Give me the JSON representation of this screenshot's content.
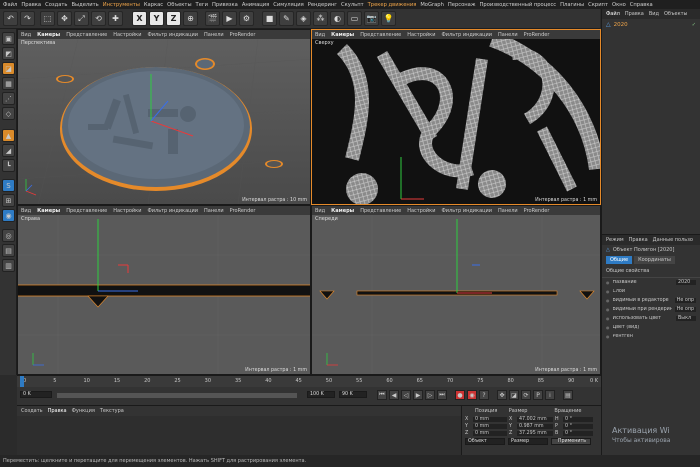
{
  "menubar": {
    "items": [
      "Файл",
      "Правка",
      "Создать",
      "Выделить",
      "Инструменты",
      "Каркас",
      "Объекты",
      "Теги",
      "Привязка",
      "Анимация",
      "Симуляция",
      "Рендеринг",
      "Скульпт",
      "Трекер движения",
      "MoGraph",
      "Персонаж",
      "Производственный процесс",
      "Плагины",
      "Скрипт",
      "Окно",
      "Справка"
    ],
    "highlight": [
      4,
      13
    ]
  },
  "toolbar": {
    "axis_buttons": [
      "X",
      "Y",
      "Z"
    ]
  },
  "viewports": [
    {
      "name": "Перспектива",
      "menu": [
        "Вид",
        "Камеры",
        "Представление",
        "Настройки",
        "Фильтр индикации",
        "Панели",
        "ProRender"
      ],
      "grid": "Интервал растра : 10 mm"
    },
    {
      "name": "Сверху",
      "menu": [
        "Вид",
        "Камеры",
        "Представление",
        "Настройки",
        "Фильтр индикации",
        "Панели",
        "ProRender"
      ],
      "grid": "Интервал растра : 1 mm"
    },
    {
      "name": "Справа",
      "menu": [
        "Вид",
        "Камеры",
        "Представление",
        "Настройки",
        "Фильтр индикации",
        "Панели",
        "ProRender"
      ],
      "grid": "Интервал растра : 1 mm"
    },
    {
      "name": "Спереди",
      "menu": [
        "Вид",
        "Камеры",
        "Представление",
        "Настройки",
        "Фильтр индикации",
        "Панели",
        "ProRender"
      ],
      "grid": "Интервал растра : 1 mm"
    }
  ],
  "object_manager": {
    "tabs": [
      "Файл",
      "Правка",
      "Вид",
      "Объекты"
    ],
    "object_name": "2020"
  },
  "attribute_manager": {
    "tabs": [
      "Режим",
      "Правка",
      "Данные пользо"
    ],
    "title": "Объект Полигон [2020]",
    "subtabs": [
      "Общие",
      "Координаты"
    ],
    "section": "Общие свойства",
    "rows": [
      {
        "label": "Название",
        "value": "2020"
      },
      {
        "label": "Слой",
        "value": ""
      },
      {
        "label": "Видимый в редакторе",
        "value": "Не опр"
      },
      {
        "label": "Видимый при рендеринге",
        "value": "Не опр"
      },
      {
        "label": "Использовать цвет",
        "value": "Выкл"
      },
      {
        "label": "Цвет (вид)",
        "value": ""
      },
      {
        "label": "Рентген",
        "value": ""
      }
    ]
  },
  "timeline": {
    "ticks": [
      "0",
      "5",
      "10",
      "15",
      "20",
      "25",
      "30",
      "35",
      "40",
      "45",
      "50",
      "55",
      "60",
      "65",
      "70",
      "75",
      "80",
      "85",
      "90"
    ],
    "end_label": "0 K",
    "current_frame": "0 K",
    "start_field": "0 K",
    "end_field": "90 K",
    "end_field2": "100 K"
  },
  "material_manager": {
    "tabs": [
      "Создать",
      "Правка",
      "Функция",
      "Текстура"
    ]
  },
  "coord_manager": {
    "headers": [
      "Позиция",
      "Размер",
      "Вращение"
    ],
    "rows": [
      {
        "axis": "X",
        "pos": "0 mm",
        "size": "47.002 mm",
        "rot_axis": "H",
        "rot": "0 °"
      },
      {
        "axis": "Y",
        "pos": "0 mm",
        "size": "0.987 mm",
        "rot_axis": "P",
        "rot": "0 °"
      },
      {
        "axis": "Z",
        "pos": "0 mm",
        "size": "37.295 mm",
        "rot_axis": "B",
        "rot": "0 °"
      }
    ],
    "mode1": "Объект",
    "mode2": "Размер",
    "apply": "Применить"
  },
  "status_text": "Переместить: щелкните и перетащите для перемещения элементов. Нажать SHIFT для растрирования элемента.",
  "watermark": {
    "line1": "Активация Wi",
    "line2": "Чтобы активирова"
  },
  "colors": {
    "accent": "#e58a2a",
    "selection_blue": "#2e7bc4",
    "background": "#2b2b2b"
  }
}
